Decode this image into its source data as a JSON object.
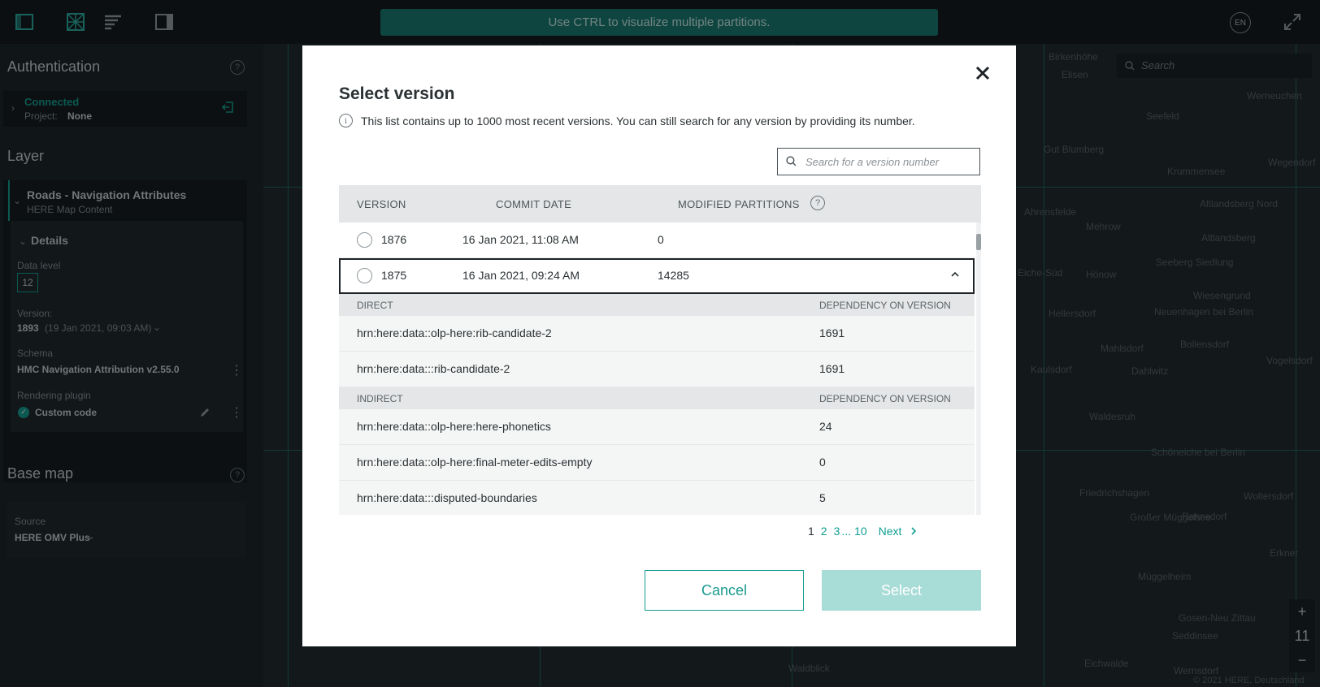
{
  "topbar": {
    "banner": "Use CTRL to visualize multiple partitions.",
    "language": "EN"
  },
  "sidebar": {
    "auth_title": "Authentication",
    "connection_status": "Connected",
    "project_label": "Project:",
    "project_value": "None",
    "layer_title": "Layer",
    "layer_name": "Roads - Navigation Attributes",
    "layer_catalog": "HERE Map Content",
    "details_label": "Details",
    "data_level_label": "Data level",
    "data_level_value": "12",
    "version_label": "Version:",
    "version_value": "1893",
    "version_date": "(19 Jan 2021, 09:03 AM)",
    "schema_label": "Schema",
    "schema_value": "HMC Navigation Attribution v2.55.0",
    "rendering_label": "Rendering plugin",
    "rendering_value": "Custom code",
    "basemap_title": "Base map",
    "source_label": "Source",
    "source_value": "HERE OMV Plus"
  },
  "map": {
    "search_placeholder": "Search",
    "zoom_level": "11",
    "zoom_in": "+",
    "zoom_out": "−",
    "places": [
      "Birkenhöhe",
      "Elisen",
      "Werneuchen",
      "Seefeld",
      "Gut Blumberg",
      "Krummensee",
      "Wegendorf",
      "Ahrensfelde",
      "Mehrow",
      "Altlandsberg Nord",
      "Altlandsberg",
      "Seeberg Siedlung",
      "Eiche-Süd",
      "Hönow",
      "Wiesengrund",
      "Hellersdorf",
      "Neuenhagen bei Berlin",
      "Bollensdorf",
      "Mahlsdorf",
      "Kaulsdorf",
      "Dahlwitz",
      "Vogelsdorf",
      "Waldesruh",
      "Schöneiche bei Berlin",
      "Friedrichshagen",
      "Woltersdorf",
      "Großer Müggelsee",
      "Rahnsdorf",
      "Müggelheim",
      "Erkner",
      "Gosen-Neu Zittau",
      "Seddinsee",
      "Eichwalde",
      "Waldblick",
      "Wernsdorf",
      "© 2021 HERE, Deutschland"
    ]
  },
  "modal": {
    "title": "Select version",
    "info": "This list contains up to 1000 most recent versions. You can still search for any version by providing its number.",
    "search_placeholder": "Search for a version number",
    "columns": {
      "version": "VERSION",
      "commit_date": "COMMIT DATE",
      "modified_partitions": "MODIFIED PARTITIONS"
    },
    "rows": [
      {
        "version": "1876",
        "date": "16 Jan 2021, 11:08 AM",
        "partitions": "0"
      },
      {
        "version": "1875",
        "date": "16 Jan 2021, 09:24 AM",
        "partitions": "14285"
      }
    ],
    "direct": {
      "label": "DIRECT",
      "dep_label": "DEPENDENCY ON VERSION",
      "items": [
        {
          "hrn": "hrn:here:data::olp-here:rib-candidate-2",
          "version": "1691"
        },
        {
          "hrn": "hrn:here:data:::rib-candidate-2",
          "version": "1691"
        }
      ]
    },
    "indirect": {
      "label": "INDIRECT",
      "dep_label": "DEPENDENCY ON VERSION",
      "items": [
        {
          "hrn": "hrn:here:data::olp-here:here-phonetics",
          "version": "24"
        },
        {
          "hrn": "hrn:here:data::olp-here:final-meter-edits-empty",
          "version": "0"
        },
        {
          "hrn": "hrn:here:data:::disputed-boundaries",
          "version": "5"
        }
      ]
    },
    "pagination": {
      "current": "1",
      "p2": "2",
      "p3": "3",
      "ellipsis": "...",
      "last": "10",
      "next": "Next"
    },
    "cancel_label": "Cancel",
    "select_label": "Select"
  },
  "colors": {
    "accent": "#1a9b90",
    "banner": "#1a7f76",
    "select_disabled": "#a8dcd7"
  }
}
